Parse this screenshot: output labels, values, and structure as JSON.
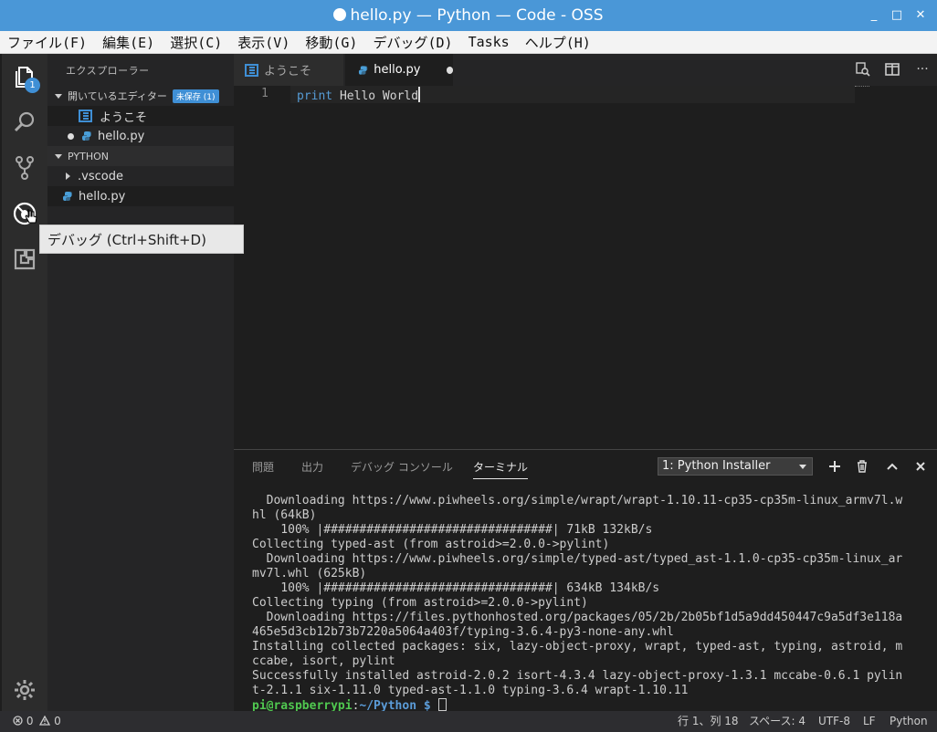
{
  "window": {
    "title": "hello.py — Python — Code - OSS",
    "minimize": "_",
    "maximize": "□",
    "close": "✕"
  },
  "menu": [
    "ファイル(F)",
    "編集(E)",
    "選択(C)",
    "表示(V)",
    "移動(G)",
    "デバッグ(D)",
    "Tasks",
    "ヘルプ(H)"
  ],
  "activity": {
    "explorer_badge": "1",
    "items": [
      "explorer",
      "search",
      "source-control",
      "debug",
      "extensions",
      "settings"
    ]
  },
  "tooltip": "デバッグ (Ctrl+Shift+D)",
  "sidebar": {
    "title": "エクスプローラー",
    "open_editors_label": "開いているエディター",
    "unsaved_badge": "未保存 (1)",
    "open_editors": [
      "ようこそ",
      "hello.py"
    ],
    "folder_label": "PYTHON",
    "tree": [
      ".vscode",
      "hello.py"
    ]
  },
  "tabs": [
    {
      "label": "ようこそ",
      "active": false
    },
    {
      "label": "hello.py",
      "active": true,
      "modified": true
    }
  ],
  "editor": {
    "line_number": "1",
    "keyword": "print",
    "text": " Hello World"
  },
  "panel": {
    "tabs": [
      "問題",
      "出力",
      "デバッグ コンソール",
      "ターミナル"
    ],
    "active_tab": "ターミナル",
    "terminal_select": "1: Python Installer",
    "terminal_lines": [
      "  Downloading https://www.piwheels.org/simple/wrapt/wrapt-1.10.11-cp35-cp35m-linux_armv7l.w",
      "hl (64kB)",
      "    100% |################################| 71kB 132kB/s",
      "Collecting typed-ast (from astroid>=2.0.0->pylint)",
      "  Downloading https://www.piwheels.org/simple/typed-ast/typed_ast-1.1.0-cp35-cp35m-linux_ar",
      "mv7l.whl (625kB)",
      "    100% |################################| 634kB 134kB/s",
      "Collecting typing (from astroid>=2.0.0->pylint)",
      "  Downloading https://files.pythonhosted.org/packages/05/2b/2b05bf1d5a9dd450447c9a5df3e118a",
      "465e5d3cb12b73b7220a5064a403f/typing-3.6.4-py3-none-any.whl",
      "Installing collected packages: six, lazy-object-proxy, wrapt, typed-ast, typing, astroid, m",
      "ccabe, isort, pylint",
      "Successfully installed astroid-2.0.2 isort-4.3.4 lazy-object-proxy-1.3.1 mccabe-0.6.1 pylin",
      "t-2.1.1 six-1.11.0 typed-ast-1.1.0 typing-3.6.4 wrapt-1.10.11"
    ],
    "prompt_user": "pi@raspberrypi",
    "prompt_sep": ":",
    "prompt_path": "~/Python $",
    "prompt_tail": " "
  },
  "status": {
    "errors": "0",
    "warnings": "0",
    "position": "行 1、列 18",
    "spaces": "スペース: 4",
    "encoding": "UTF-8",
    "eol": "LF",
    "language": "Python"
  },
  "colors": {
    "titlebar": "#4a97d7",
    "accent": "#3f8fd5",
    "terminal_user": "#50c850",
    "terminal_path": "#5b9cd8"
  }
}
